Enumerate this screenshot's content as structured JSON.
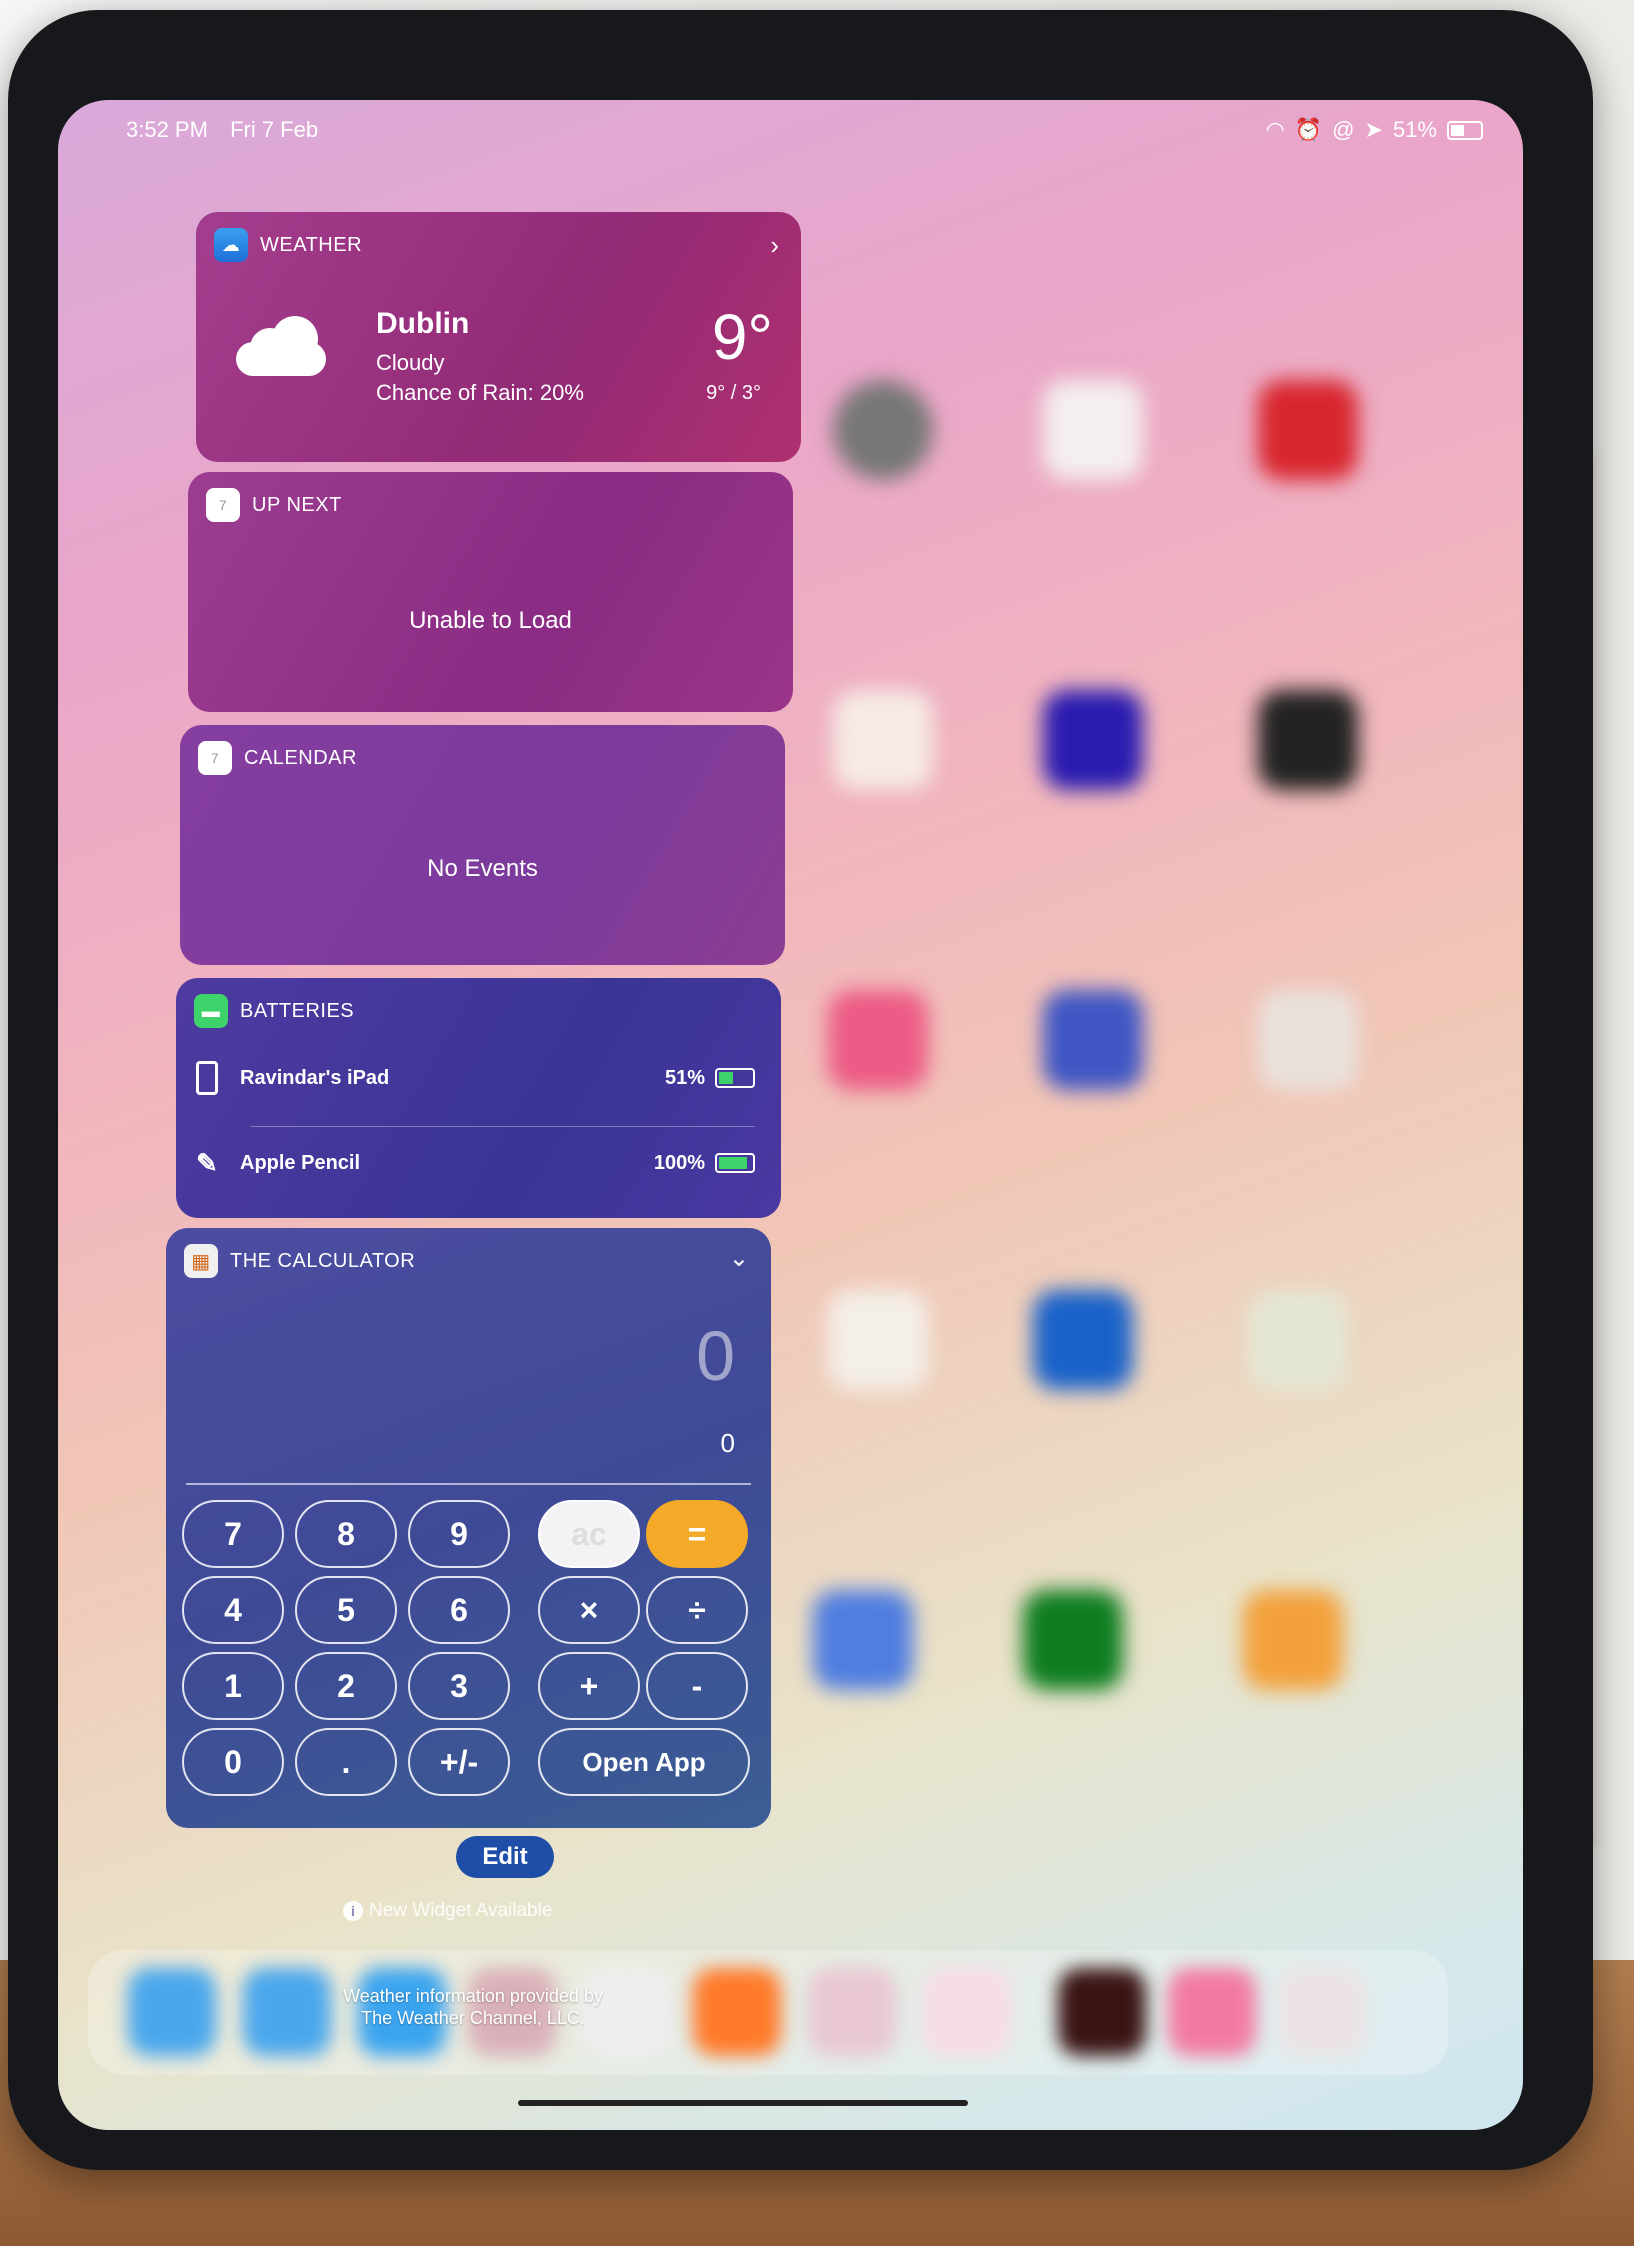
{
  "status_bar": {
    "time": "3:52 PM",
    "date": "Fri 7 Feb",
    "battery": "51%"
  },
  "weather": {
    "header": "WEATHER",
    "city": "Dublin",
    "condition": "Cloudy",
    "rain": "Chance of Rain: 20%",
    "temp": "9°",
    "high_low": "9° / 3°"
  },
  "up_next": {
    "header": "UP NEXT",
    "message": "Unable to Load",
    "icon_day": "7"
  },
  "calendar": {
    "header": "CALENDAR",
    "message": "No Events",
    "icon_day": "7"
  },
  "batteries": {
    "header": "BATTERIES",
    "devices": [
      {
        "name": "Ravindar's iPad",
        "percent": "51%",
        "level": 0.51
      },
      {
        "name": "Apple Pencil",
        "percent": "100%",
        "level": 1.0
      }
    ]
  },
  "calculator": {
    "header": "THE CALCULATOR",
    "display": "0",
    "subdisplay": "0",
    "keys": [
      "7",
      "8",
      "9",
      "ac",
      "=",
      "4",
      "5",
      "6",
      "×",
      "÷",
      "1",
      "2",
      "3",
      "+",
      "-",
      "0",
      ".",
      "+/-",
      "Open App"
    ]
  },
  "edit_label": "Edit",
  "new_widget": "New Widget Available",
  "credit_line1": "Weather information provided by",
  "credit_line2": "The Weather Channel, LLC.",
  "colors": {
    "accent_orange": "#f5a929",
    "battery_green": "#3ed36a",
    "edit_blue": "#1f4ea8"
  }
}
